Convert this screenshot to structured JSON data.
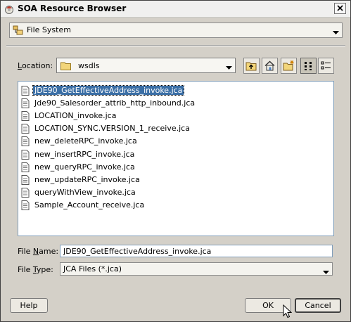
{
  "window": {
    "title": "SOA Resource Browser",
    "close_icon": "close-icon"
  },
  "source": {
    "selected": "File System",
    "icon": "file-system-icon"
  },
  "location": {
    "label": "Location:",
    "value": "wsdls",
    "icon": "folder-icon",
    "toolbar": [
      "folder-up-icon",
      "home-icon",
      "new-folder-icon",
      "list-view-icon",
      "details-view-icon"
    ],
    "active_view": "list-view-icon"
  },
  "files": [
    {
      "name": "JDE90_GetEffectiveAddress_invoke.jca",
      "selected": true
    },
    {
      "name": "Jde90_Salesorder_attrib_http_inbound.jca",
      "selected": false
    },
    {
      "name": "LOCATION_invoke.jca",
      "selected": false
    },
    {
      "name": "LOCATION_SYNC.VERSION_1_receive.jca",
      "selected": false
    },
    {
      "name": "new_deleteRPC_invoke.jca",
      "selected": false
    },
    {
      "name": "new_insertRPC_invoke.jca",
      "selected": false
    },
    {
      "name": "new_queryRPC_invoke.jca",
      "selected": false
    },
    {
      "name": "new_updateRPC_invoke.jca",
      "selected": false
    },
    {
      "name": "queryWithView_invoke.jca",
      "selected": false
    },
    {
      "name": "Sample_Account_receive.jca",
      "selected": false
    }
  ],
  "file_name": {
    "label": "File Name:",
    "value": "JDE90_GetEffectiveAddress_invoke.jca"
  },
  "file_type": {
    "label": "File Type:",
    "value": "JCA Files (*.jca)"
  },
  "buttons": {
    "help": "Help",
    "ok": "OK",
    "cancel": "Cancel"
  },
  "colors": {
    "dialog_bg": "#d4d0c8",
    "selection": "#3a6ea5",
    "list_bg": "#ffffff"
  }
}
